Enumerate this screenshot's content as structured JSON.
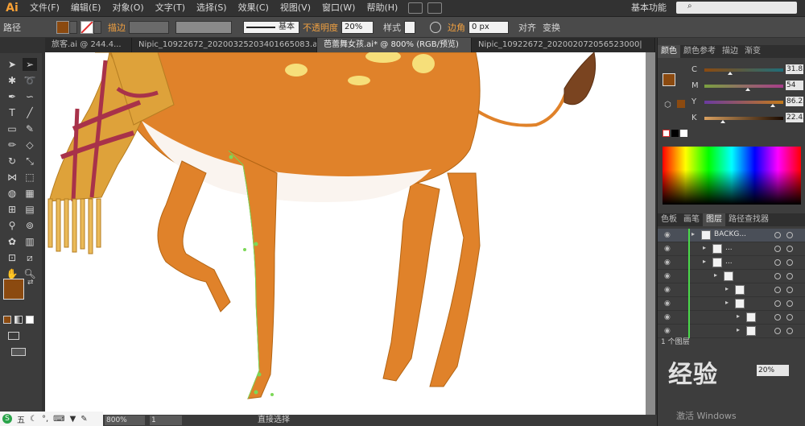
{
  "app": {
    "logo": "Ai",
    "menus": [
      "文件(F)",
      "编辑(E)",
      "对象(O)",
      "文字(T)",
      "选择(S)",
      "效果(C)",
      "视图(V)",
      "窗口(W)",
      "帮助(H)"
    ],
    "workspace": "基本功能",
    "search_icon": "search-icon"
  },
  "controlbar": {
    "object_type": "路径",
    "stroke_label": "描边",
    "stroke_style": "基本",
    "opacity_label": "不透明度",
    "opacity_value": "20%",
    "style_label": "样式",
    "corner_label": "边角",
    "corner_value": "0 px",
    "align_label": "对齐",
    "transform_label": "变换",
    "fill_color": "#8b4a10"
  },
  "tabs": [
    {
      "label": "旅客.ai @ 244.4..."
    },
    {
      "label": "Nipic_10922672_20200325203401665083.ai*"
    },
    {
      "label": "芭蕾舞女孩.ai* @ 800% (RGB/预览)"
    },
    {
      "label": "Nipic_10922672_202002072056523000|"
    }
  ],
  "color_panel": {
    "tabs": [
      "颜色",
      "颜色参考",
      "描边",
      "渐变"
    ],
    "channels": [
      {
        "label": "C",
        "value": "31.83",
        "level": 0.32,
        "gradient": "linear-gradient(90deg,#8b4a10,#1f6e7a)"
      },
      {
        "label": "M",
        "value": "54",
        "level": 0.54,
        "gradient": "linear-gradient(90deg,#7aa040,#a83c8a)"
      },
      {
        "label": "Y",
        "value": "86.23",
        "level": 0.86,
        "gradient": "linear-gradient(90deg,#6a3aa0,#c47a1a)"
      },
      {
        "label": "K",
        "value": "22.43",
        "level": 0.22,
        "gradient": "linear-gradient(90deg,#d9a060,#1a0a00)"
      }
    ]
  },
  "layers_panel": {
    "tabs": [
      "色板",
      "画笔",
      "图层",
      "路径查找器"
    ],
    "rows": [
      {
        "name": "BACKG...",
        "indent": 0
      },
      {
        "name": "...",
        "indent": 1
      },
      {
        "name": "...",
        "indent": 1
      },
      {
        "name": "",
        "indent": 2
      },
      {
        "name": "",
        "indent": 3
      },
      {
        "name": "",
        "indent": 3
      },
      {
        "name": "",
        "indent": 4
      },
      {
        "name": "",
        "indent": 4
      }
    ],
    "footer": "1 个图层"
  },
  "status": {
    "zoom": "800%",
    "page": "1",
    "tool": "直接选择"
  },
  "ime": {
    "label": "五"
  },
  "watermark": {
    "text": "经验",
    "opacity": "20%"
  },
  "activate": "激活 Windows"
}
